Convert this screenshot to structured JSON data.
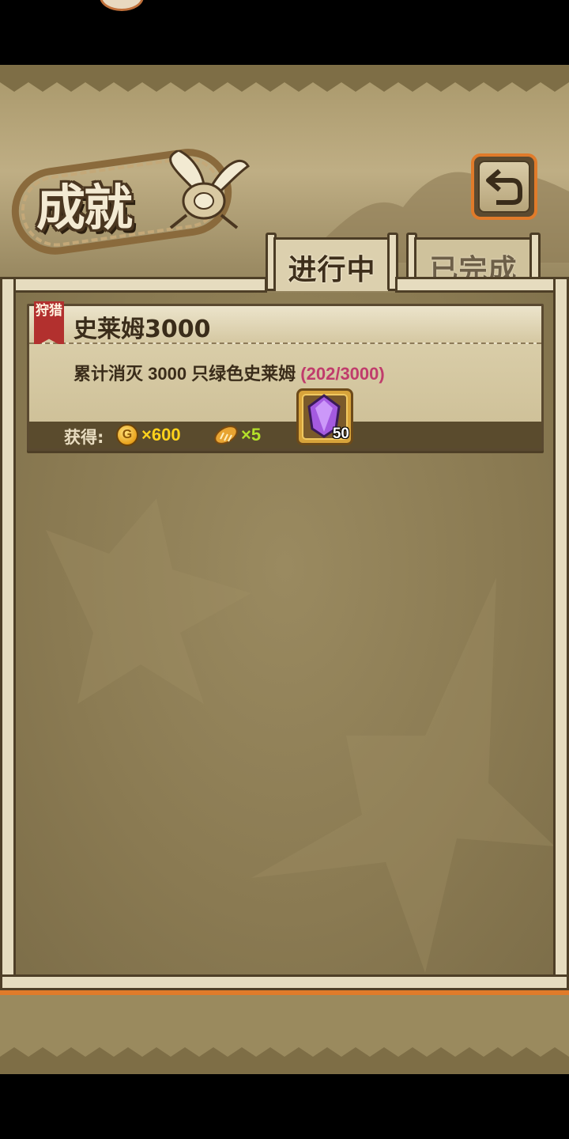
{
  "screen": {
    "title": "成就",
    "back_button_icon": "return-arrow-icon"
  },
  "tabs": [
    {
      "label": "进行中",
      "active": true
    },
    {
      "label": "已完成",
      "active": false
    }
  ],
  "quests": [
    {
      "category_badge": "狩猎",
      "title": "史莱姆3000",
      "description": "累计消灭 3000 只绿色史莱姆",
      "progress_text": "(202/3000)",
      "progress": {
        "current": 202,
        "total": 3000
      },
      "rewards_label": "获得:",
      "rewards": [
        {
          "icon": "gold-coin-icon",
          "coin_letter": "G",
          "qty": "×600"
        },
        {
          "icon": "bread-icon",
          "qty": "×5"
        },
        {
          "icon": "purple-gem-icon",
          "qty": "50"
        }
      ]
    }
  ],
  "colors": {
    "progress": "#c03c6c",
    "gold_qty": "#ffd21c",
    "bread_qty": "#b4e02a",
    "tab_border_accent": "#e07b2a"
  }
}
